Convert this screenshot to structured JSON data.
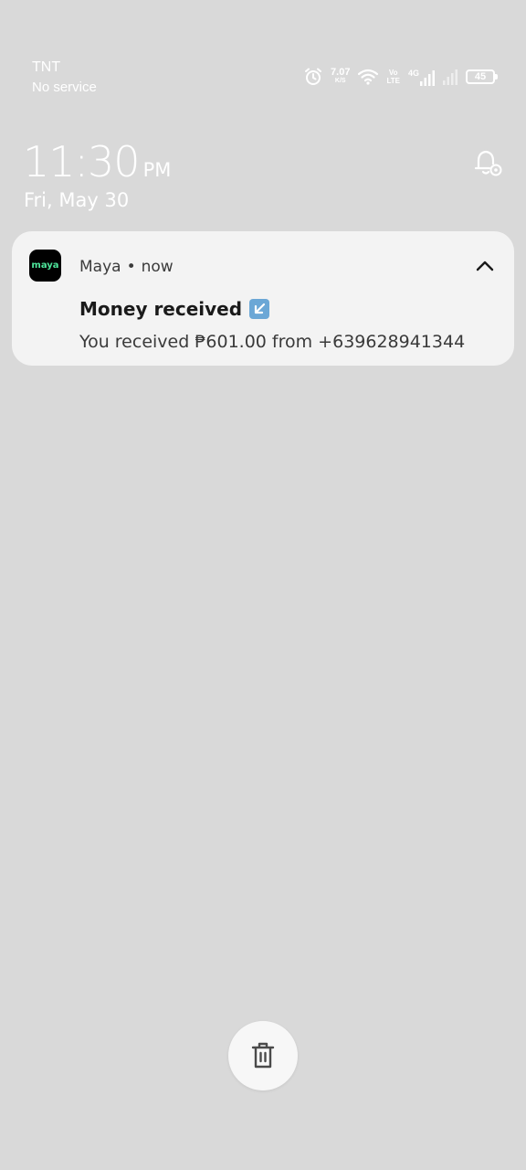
{
  "status_bar": {
    "carrier": "TNT",
    "service": "No service",
    "net_speed_value": "7.07",
    "net_speed_unit": "K/S",
    "volte_top": "Vo",
    "volte_bottom": "LTE",
    "network_type": "4G",
    "battery_level": "45",
    "icons": [
      "alarm-icon",
      "wifi-icon",
      "signal-icon",
      "signal-icon-2",
      "battery-icon"
    ]
  },
  "lockscreen": {
    "time": "11:30",
    "ampm": "PM",
    "date": "Fri, May 30"
  },
  "notification": {
    "app_icon_text": "maya",
    "app_name": "Maya",
    "separator": "•",
    "timestamp": "now",
    "title": "Money received",
    "body": "You received ₱601.00 from +639628941344",
    "app_icon_color": "#4ee59b"
  },
  "actions": {
    "clear_icon": "trash-icon"
  }
}
